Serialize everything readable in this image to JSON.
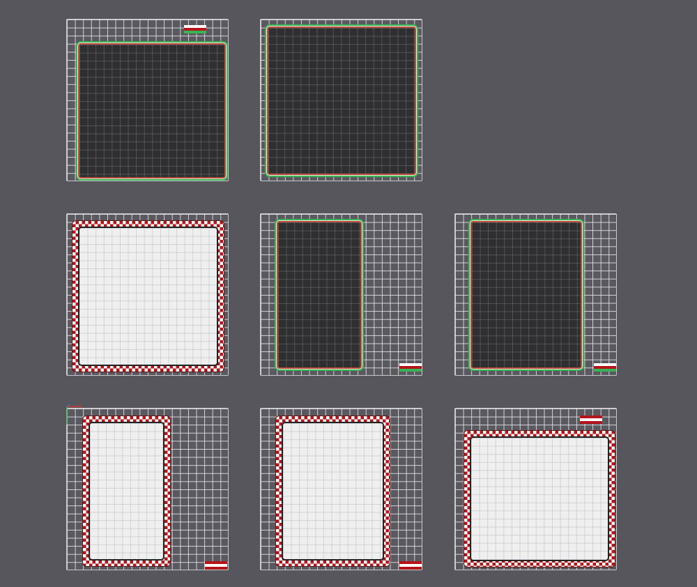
{
  "viewport": {
    "background": "#57565c",
    "colors": {
      "checker_red": "#b3151b",
      "outline_green": "#37b456",
      "outline_red": "#b84a3a",
      "dark_part": "#2f2f31",
      "light_part": "#efefef"
    }
  },
  "plates": [
    {
      "row": 1,
      "col": 1,
      "part_style": "dark",
      "marker": "red-white-green"
    },
    {
      "row": 1,
      "col": 2,
      "part_style": "dark",
      "marker": "none"
    },
    {
      "row": 2,
      "col": 1,
      "part_style": "light-checker",
      "marker": "none"
    },
    {
      "row": 2,
      "col": 2,
      "part_style": "dark",
      "marker": "red-white-green"
    },
    {
      "row": 2,
      "col": 3,
      "part_style": "dark",
      "marker": "red-white-green"
    },
    {
      "row": 3,
      "col": 1,
      "part_style": "light-checker",
      "marker": "red-white-red"
    },
    {
      "row": 3,
      "col": 2,
      "part_style": "light-checker",
      "marker": "red-white-red"
    },
    {
      "row": 3,
      "col": 3,
      "part_style": "light-checker",
      "marker": "red-white-red"
    }
  ],
  "icons": {
    "axis_gizmo": "xyz-axis-icon"
  }
}
